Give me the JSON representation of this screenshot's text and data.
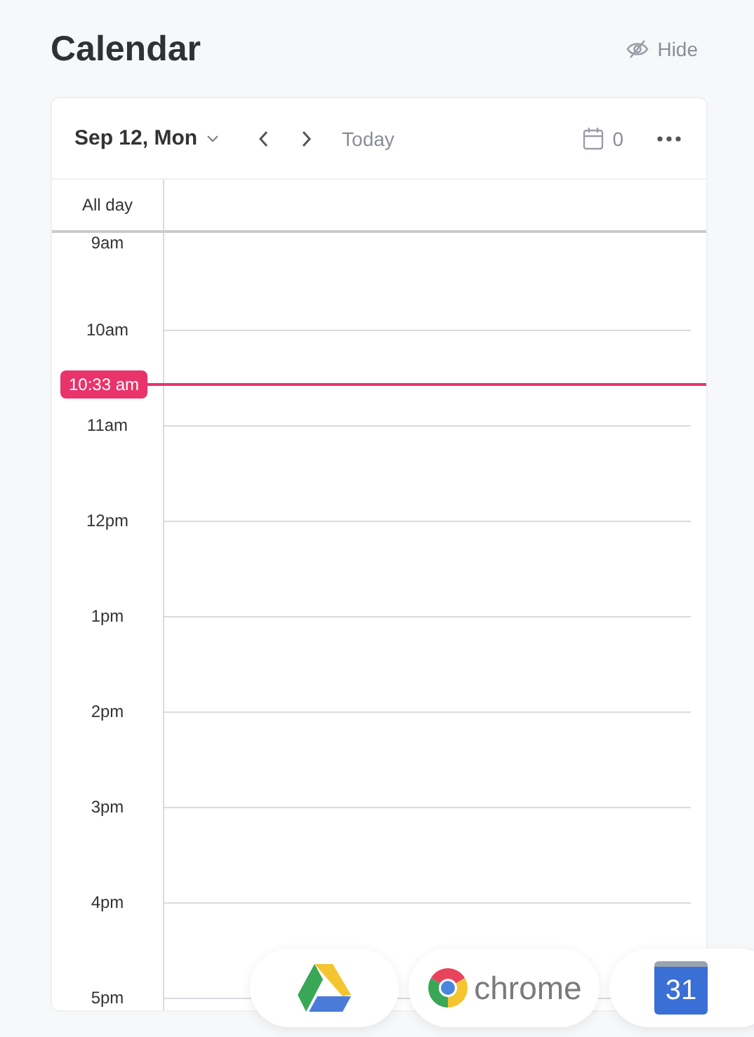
{
  "title": "Calendar",
  "hide_label": "Hide",
  "header": {
    "date": "Sep 12, Mon",
    "today": "Today",
    "event_count": "0"
  },
  "all_day_label": "All day",
  "hours": [
    "9am",
    "10am",
    "11am",
    "12pm",
    "1pm",
    "2pm",
    "3pm",
    "4pm",
    "5pm"
  ],
  "now": {
    "label": "10:33 am"
  },
  "dock": [
    {
      "kind": "drive"
    },
    {
      "kind": "chrome",
      "label": "chrome"
    },
    {
      "kind": "calendar",
      "label": "31"
    }
  ]
}
